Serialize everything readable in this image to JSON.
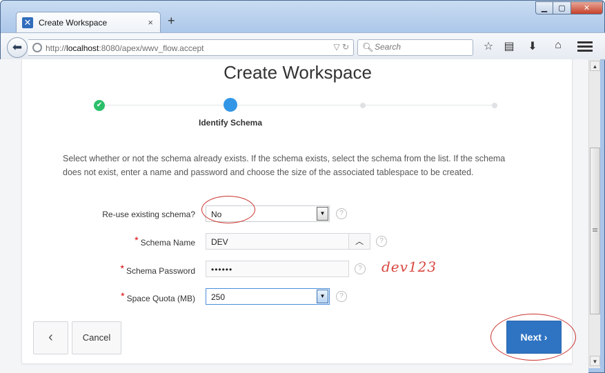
{
  "browser": {
    "tab_title": "Create Workspace",
    "tab_close": "×",
    "new_tab": "+",
    "url_prefix": "http://",
    "url_host": "localhost",
    "url_rest": ":8080/apex/wwv_flow.accept",
    "search_placeholder": "Search",
    "window_buttons": [
      "minimize",
      "maximize",
      "close"
    ],
    "toolbar_icons": [
      "star-icon",
      "reading-list-icon",
      "download-icon",
      "home-icon",
      "menu-icon"
    ]
  },
  "page": {
    "title": "Create Workspace",
    "wizard": {
      "current_step_label": "Identify Schema",
      "steps": [
        "complete",
        "current",
        "pending",
        "pending"
      ]
    },
    "intro": "Select whether or not the schema already exists. If the schema exists, select the schema from the list. If the schema does not exist, enter a name and password and choose the size of the associated tablespace to be created.",
    "fields": {
      "reuse_schema": {
        "label": "Re-use existing schema?",
        "value": "No"
      },
      "schema_name": {
        "label": "Schema Name",
        "value": "DEV"
      },
      "schema_password": {
        "label": "Schema Password",
        "value": "••••••"
      },
      "space_quota": {
        "label": "Space Quota (MB)",
        "value": "250"
      }
    },
    "help_glyph": "?",
    "annotation_note": "dev123",
    "buttons": {
      "back": "‹",
      "cancel": "Cancel",
      "next": "Next ›"
    }
  },
  "colors": {
    "accent": "#2f74c2",
    "step_done": "#2bbf6a",
    "step_current": "#3296e6",
    "annotation": "#c9322c"
  }
}
